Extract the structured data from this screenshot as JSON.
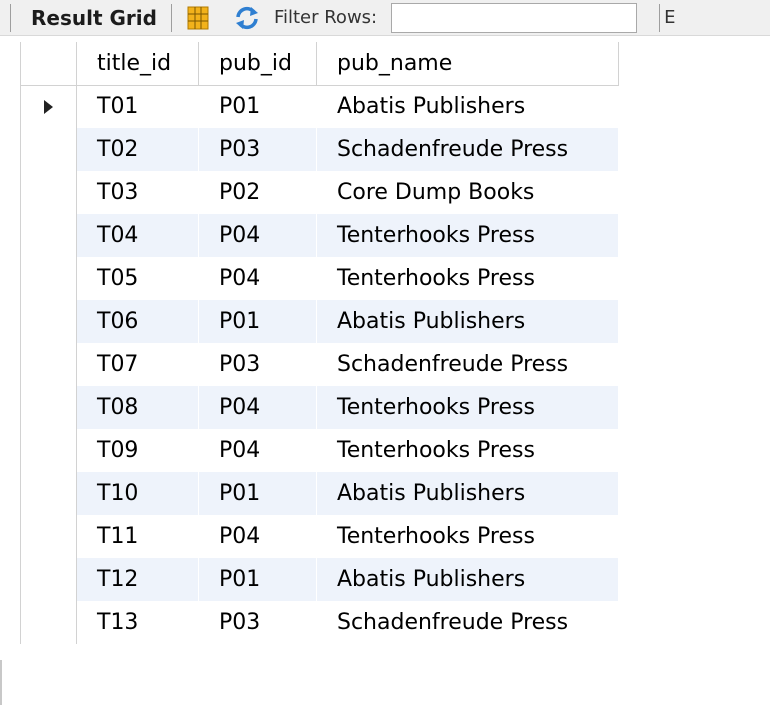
{
  "toolbar": {
    "result_grid_label": "Result Grid",
    "filter_label": "Filter Rows:",
    "filter_value": "",
    "edit_label_partial": "E"
  },
  "grid": {
    "columns": [
      "title_id",
      "pub_id",
      "pub_name"
    ],
    "selected_row": 0,
    "rows": [
      {
        "title_id": "T01",
        "pub_id": "P01",
        "pub_name": "Abatis Publishers"
      },
      {
        "title_id": "T02",
        "pub_id": "P03",
        "pub_name": "Schadenfreude Press"
      },
      {
        "title_id": "T03",
        "pub_id": "P02",
        "pub_name": "Core Dump Books"
      },
      {
        "title_id": "T04",
        "pub_id": "P04",
        "pub_name": "Tenterhooks Press"
      },
      {
        "title_id": "T05",
        "pub_id": "P04",
        "pub_name": "Tenterhooks Press"
      },
      {
        "title_id": "T06",
        "pub_id": "P01",
        "pub_name": "Abatis Publishers"
      },
      {
        "title_id": "T07",
        "pub_id": "P03",
        "pub_name": "Schadenfreude Press"
      },
      {
        "title_id": "T08",
        "pub_id": "P04",
        "pub_name": "Tenterhooks Press"
      },
      {
        "title_id": "T09",
        "pub_id": "P04",
        "pub_name": "Tenterhooks Press"
      },
      {
        "title_id": "T10",
        "pub_id": "P01",
        "pub_name": "Abatis Publishers"
      },
      {
        "title_id": "T11",
        "pub_id": "P04",
        "pub_name": "Tenterhooks Press"
      },
      {
        "title_id": "T12",
        "pub_id": "P01",
        "pub_name": "Abatis Publishers"
      },
      {
        "title_id": "T13",
        "pub_id": "P03",
        "pub_name": "Schadenfreude Press"
      }
    ]
  },
  "icons": {
    "grid": "grid-view-icon",
    "refresh": "refresh-icon",
    "row_indicator": "current-row-arrow-icon"
  },
  "colors": {
    "alt_row": "#eef3fb",
    "toolbar_bg": "#f0f0f0",
    "grid_icon_accent": "#f2b21b",
    "refresh_icon_accent": "#2f7fd1"
  }
}
